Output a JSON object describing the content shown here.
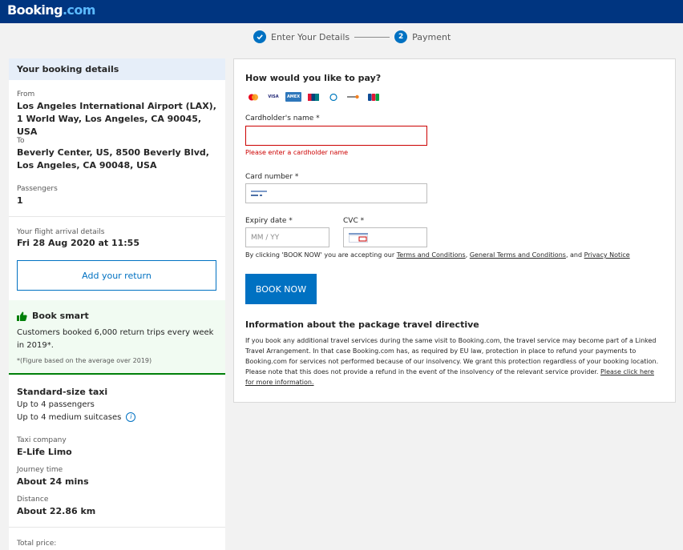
{
  "header": {
    "logo_main": "Booking",
    "logo_suffix": ".com"
  },
  "steps": [
    {
      "label": "Enter Your Details",
      "state": "done"
    },
    {
      "number": "2",
      "label": "Payment",
      "state": "current"
    }
  ],
  "sidebar": {
    "title": "Your booking details",
    "from_label": "From",
    "from_value": "Los Angeles International Airport (LAX), 1 World Way, Los Angeles, CA 90045, USA",
    "to_label": "To",
    "to_value": "Beverly Center, US, 8500 Beverly Blvd, Los Angeles, CA 90048, USA",
    "passengers_label": "Passengers",
    "passengers_value": "1",
    "flight_label": "Your flight arrival details",
    "flight_value": "Fri 28 Aug 2020 at 11:55",
    "add_return": "Add your return",
    "book_smart_title": "Book smart",
    "book_smart_text": "Customers booked 6,000 return trips every week in 2019*.",
    "book_smart_note": "*(Figure based on the average over 2019)",
    "car_title": "Standard-size taxi",
    "car_passengers": "Up to 4 passengers",
    "car_suitcases": "Up to 4 medium suitcases",
    "company_label": "Taxi company",
    "company_value": "E-Life Limo",
    "journey_label": "Journey time",
    "journey_value": "About 24 mins",
    "distance_label": "Distance",
    "distance_value": "About 22.86 km",
    "total_label": "Total price:"
  },
  "payment": {
    "title": "How would you like to pay?",
    "card_brands": [
      "mastercard-icon",
      "visa-icon",
      "amex-icon",
      "unionpay-icon",
      "diners-icon",
      "discover-icon",
      "jcb-icon"
    ],
    "cardholder_label": "Cardholder's name *",
    "cardholder_value": "",
    "cardholder_error": "Please enter a cardholder name",
    "card_number_label": "Card number *",
    "card_number_value": "",
    "expiry_label": "Expiry date *",
    "expiry_placeholder": "MM / YY",
    "cvc_label": "CVC *",
    "terms_prefix": "By clicking 'BOOK NOW' you are accepting our ",
    "terms_link1": "Terms and Conditions",
    "terms_sep1": ", ",
    "terms_link2": "General Terms and Conditions",
    "terms_sep2": ", and ",
    "terms_link3": "Privacy Notice",
    "book_now": "BOOK NOW",
    "directive_title": "Information about the package travel directive",
    "directive_text": "If you book any additional travel services during the same visit to Booking.com, the travel service may become part of a Linked Travel Arrangement. In that case Booking.com has, as required by EU law, protection in place to refund your payments to Booking.com for services not performed because of our insolvency. We grant this protection regardless of your booking location. Please note that this does not provide a refund in the event of the insolvency of the relevant service provider. ",
    "directive_link": "Please click here for more information."
  },
  "colors": {
    "brand_blue": "#003580",
    "action_blue": "#0071c2",
    "error_red": "#cc0000",
    "success_green": "#008009"
  }
}
